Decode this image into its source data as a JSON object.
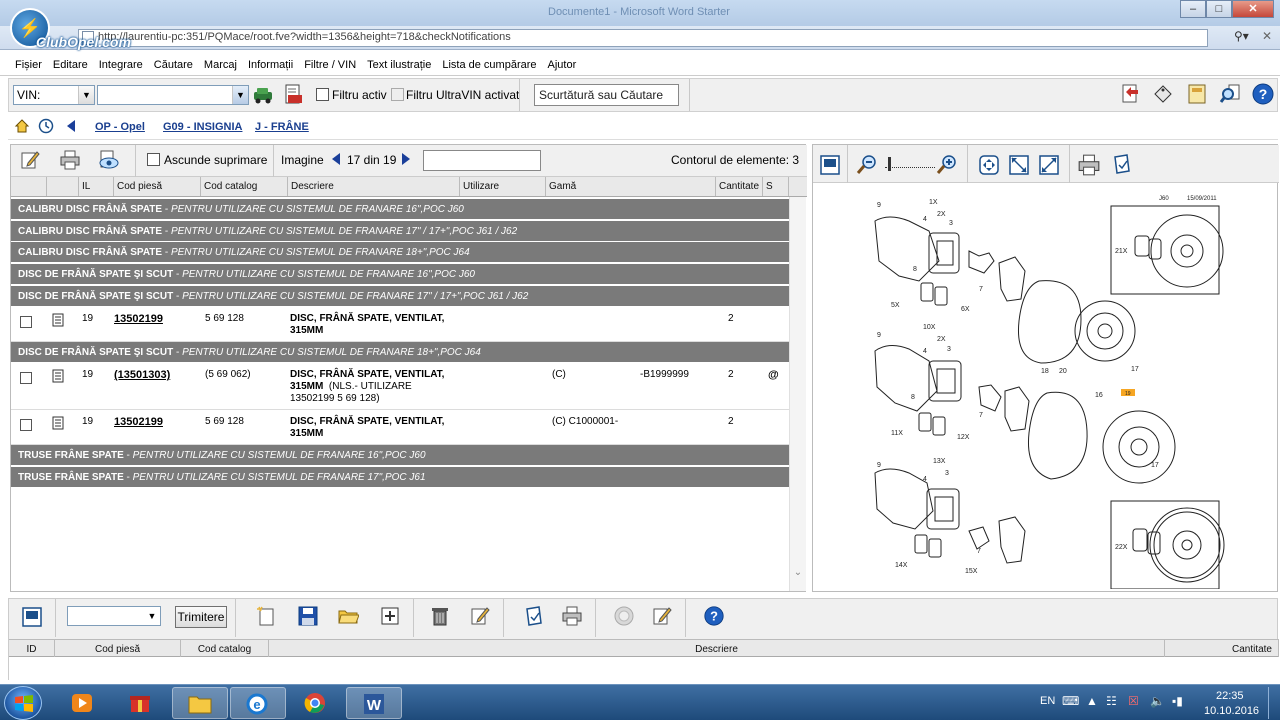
{
  "window": {
    "title": "Documente1 - Microsoft Word Starter"
  },
  "browser": {
    "logo_text": "ClubOpel.com",
    "address": "http://laurentiu-pc:351/PQMace/root.fve?width=1356&height=718&checkNotifications"
  },
  "menu": [
    "Fișier",
    "Editare",
    "Integrare",
    "Căutare",
    "Marcaj",
    "Informații",
    "Filtre / VIN",
    "Text ilustrație",
    "Lista de cumpărare",
    "Ajutor"
  ],
  "toolbar": {
    "vin_select": "VIN:",
    "vin_input": "",
    "filter_active_label": "Filtru activ",
    "filter_ultravin_label": "Filtru UltraVIN activat",
    "search_placeholder": "Scurtătură sau Căutare"
  },
  "breadcrumb": [
    "OP - Opel",
    "G09 - INSIGNIA",
    "J - FRÂNE"
  ],
  "parts_toolbar": {
    "hide_deleted_label": "Ascunde suprimare",
    "image_label": "Imagine",
    "image_counter": "17 din 19",
    "image_input": "",
    "contour_label": "Contorul de elemente: 3"
  },
  "columns": [
    "",
    "",
    "IL",
    "Cod piesă",
    "Cod catalog",
    "Descriere",
    "Utilizare",
    "Gamă",
    "Cantitate",
    "S"
  ],
  "groups": [
    {
      "title": "CALIBRU DISC FRÂNĂ SPATE",
      "note": "PENTRU UTILIZARE CU SISTEMUL DE FRANARE 16\",POC J60"
    },
    {
      "title": "CALIBRU DISC FRÂNĂ SPATE",
      "note": "PENTRU UTILIZARE CU SISTEMUL DE FRANARE 17\" / 17+\",POC J61 / J62"
    },
    {
      "title": "CALIBRU DISC FRÂNĂ SPATE",
      "note": "PENTRU UTILIZARE CU SISTEMUL DE FRANARE 18+\",POC J64"
    },
    {
      "title": "DISC DE FRÂNĂ SPATE ŞI SCUT",
      "note": "PENTRU UTILIZARE CU SISTEMUL DE FRANARE 16\",POC J60"
    },
    {
      "title": "DISC DE FRÂNĂ SPATE ŞI SCUT",
      "note": "PENTRU UTILIZARE CU SISTEMUL DE FRANARE 17\" / 17+\",POC J61 / J62"
    },
    {
      "title": "DISC DE FRÂNĂ SPATE ŞI SCUT",
      "note": "PENTRU UTILIZARE CU SISTEMUL DE FRANARE 18+\",POC J64"
    },
    {
      "title": "TRUSE FRÂNE SPATE",
      "note": "PENTRU UTILIZARE CU SISTEMUL DE FRANARE 16\",POC J60"
    },
    {
      "title": "TRUSE FRÂNE SPATE",
      "note": "PENTRU UTILIZARE CU SISTEMUL DE FRANARE 17\",POC J61"
    }
  ],
  "parts": [
    {
      "il": "19",
      "code": "13502199",
      "catalog": "5 69 128",
      "desc": "DISC, FRÂNĂ SPATE, VENTILAT, 315MM",
      "desc_note": "",
      "use": "",
      "range": "",
      "qty": "2",
      "s": ""
    },
    {
      "il": "19",
      "code": "(13501303)",
      "catalog": "(5 69 062)",
      "desc": "DISC, FRÂNĂ SPATE, VENTILAT, 315MM",
      "desc_note": "(NLS.- UTILIZARE 13502199 5 69 128)",
      "use": "(C)",
      "range": "-B1999999",
      "qty": "2",
      "s": "@"
    },
    {
      "il": "19",
      "code": "13502199",
      "catalog": "5 69 128",
      "desc": "DISC, FRÂNĂ SPATE, VENTILAT, 315MM",
      "desc_note": "",
      "use": "(C) C1000001-",
      "range": "",
      "qty": "2",
      "s": ""
    }
  ],
  "diagram": {
    "header_code": "J60",
    "header_date": "15/09/2011",
    "labels": [
      "9",
      "1X",
      "2X",
      "3",
      "4",
      "8",
      "5X",
      "6X",
      "7",
      "9",
      "10X",
      "2X",
      "3",
      "4",
      "8",
      "11X",
      "12X",
      "7",
      "18",
      "20",
      "16",
      "17",
      "19",
      "13X",
      "3",
      "4",
      "9",
      "14X",
      "15X",
      "7",
      "17",
      "21X",
      "22X"
    ]
  },
  "bottom": {
    "select_value": "",
    "send_button": "Trimitere",
    "columns": [
      "ID",
      "Cod piesă",
      "Cod catalog",
      "Descriere",
      "Cantitate"
    ]
  },
  "taskbar": {
    "lang": "EN",
    "time": "22:35",
    "date": "10.10.2016"
  }
}
